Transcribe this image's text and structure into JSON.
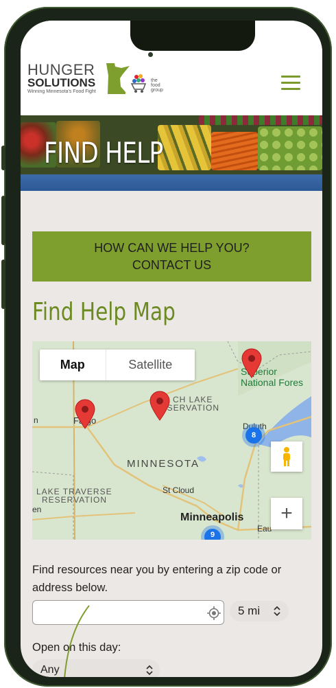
{
  "header": {
    "logo_line1": "HUNGER",
    "logo_line2": "SOLUTIONS",
    "logo_tagline": "Winning Minnesota's Food Fight",
    "partner_logo_text": "the food group"
  },
  "hero": {
    "title": "FIND HELP"
  },
  "cta": {
    "line1": "HOW CAN WE HELP YOU?",
    "line2": "CONTACT US"
  },
  "map_section": {
    "title": "Find Help Map",
    "tabs": [
      "Map",
      "Satellite"
    ],
    "labels": {
      "superior": "Superior",
      "national_forest": "National Fores",
      "leech_lake_1": "CH LAKE",
      "leech_lake_2": "RESERVATION",
      "fargo": "Fa go",
      "duluth": "Duluth",
      "minnesota": "MINNESOTA",
      "lake_traverse_1": "LAKE TRAVERSE",
      "lake_traverse_2": "RESERVATION",
      "st_cloud": "St Cloud",
      "minneapolis": "Minneapolis",
      "eau": "Eau",
      "edge_n": "n",
      "edge_en": "en"
    },
    "clusters": {
      "duluth": "8",
      "minneapolis": "9"
    },
    "zoom_in": "+"
  },
  "search": {
    "prompt": "Find resources near you by entering a zip code or address below.",
    "input_placeholder": "",
    "radius": "5 mi",
    "day_label": "Open on this day:",
    "day_value": "Any"
  },
  "colors": {
    "brand_green": "#7e9e2e",
    "title_green": "#6c8a22",
    "marker_red": "#e53935",
    "cluster_blue": "#1a73e8"
  }
}
